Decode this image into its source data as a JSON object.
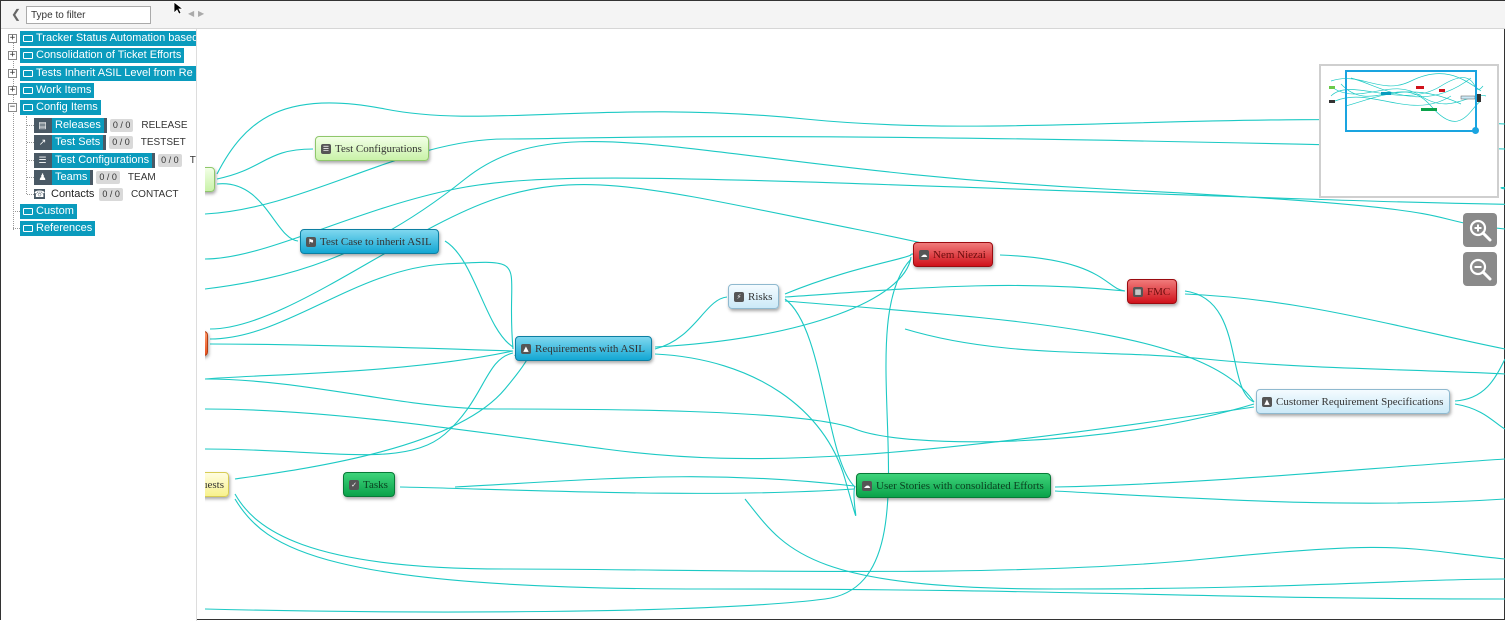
{
  "filter": {
    "placeholder": "Type to filter"
  },
  "tree": {
    "folders": [
      {
        "label": "Tracker Status Automation based",
        "expanded": false
      },
      {
        "label": "Consolidation of Ticket Efforts",
        "expanded": false
      },
      {
        "label": "Tests Inherit ASIL Level from Re",
        "expanded": false
      },
      {
        "label": "Work Items",
        "expanded": false
      },
      {
        "label": "Config Items",
        "expanded": true
      },
      {
        "label": "Custom"
      },
      {
        "label": "References"
      }
    ],
    "config_children": [
      {
        "label": "Releases",
        "badge": "0 / 0",
        "type": "RELEASE",
        "icon": "release-icon"
      },
      {
        "label": "Test Sets",
        "badge": "0 / 0",
        "type": "TESTSET",
        "icon": "testset-icon"
      },
      {
        "label": "Test Configurations",
        "badge": "0 / 0",
        "type": "TE",
        "icon": "test-config-icon"
      },
      {
        "label": "Teams",
        "badge": "0 / 0",
        "type": "TEAM",
        "icon": "team-icon"
      },
      {
        "label": "Contacts",
        "badge": "0 / 0",
        "type": "CONTACT",
        "icon": "contact-icon"
      }
    ]
  },
  "graph": {
    "nodes": {
      "test_configurations": "Test Configurations",
      "test_case_asil": "Test Case to inherit ASIL",
      "requirements_asil": "Requirements with ASIL",
      "risks": "Risks",
      "red_a": "Nem Niezai",
      "red_b": "FMC",
      "customer_reqs": "Customer Requirement Specifications",
      "tasks": "Tasks",
      "user_stories": "User Stories with consolidated Efforts",
      "yellow_partial": "uests"
    },
    "edge_color": "#1cc9c4"
  }
}
